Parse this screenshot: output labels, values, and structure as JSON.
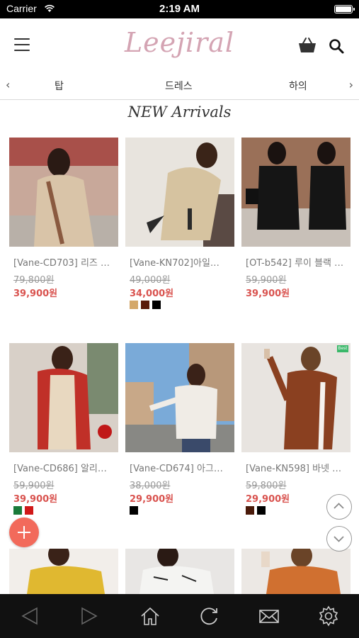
{
  "status_bar": {
    "carrier": "Carrier",
    "time": "2:19 AM"
  },
  "header": {
    "logo": "Leejiral"
  },
  "category_nav": {
    "prev_icon": "chevron-left-icon",
    "next_icon": "chevron-right-icon",
    "categories": [
      "탑",
      "드레스",
      "하의"
    ]
  },
  "section_title": "NEW Arrivals",
  "products": [
    {
      "name": "[Vane-CD703] 리즈 …",
      "original_price": "79,800원",
      "sale_price": "39,900원",
      "swatches": [],
      "best": false
    },
    {
      "name": "[Vane-KN702]아일…",
      "original_price": "49,000원",
      "sale_price": "34,000원",
      "swatches": [
        "#d4a86a",
        "#5a1a0a",
        "#000000"
      ],
      "best": false
    },
    {
      "name": "[OT-b542] 루이 블랙 …",
      "original_price": "59,900원",
      "sale_price": "39,900원",
      "swatches": [],
      "best": false
    },
    {
      "name": "[Vane-CD686] 알리…",
      "original_price": "59,900원",
      "sale_price": "39,900원",
      "swatches": [
        "#1a7a3a",
        "#d01818"
      ],
      "best": false
    },
    {
      "name": "[Vane-CD674] 아그…",
      "original_price": "38,000원",
      "sale_price": "29,900원",
      "swatches": [
        "#000000"
      ],
      "best": false
    },
    {
      "name": "[Vane-KN598] 바넷 …",
      "original_price": "59,800원",
      "sale_price": "29,900원",
      "swatches": [
        "#4a1a0a",
        "#000000"
      ],
      "best": true,
      "badge": "Best"
    }
  ],
  "colors": {
    "accent": "#d9534f",
    "logo": "#d4a4b3",
    "fab": "#f26a5b",
    "toolbar": "#111111"
  },
  "toolbar": {
    "icons": [
      "back-icon",
      "forward-icon",
      "home-icon",
      "refresh-icon",
      "mail-icon",
      "settings-icon"
    ]
  }
}
